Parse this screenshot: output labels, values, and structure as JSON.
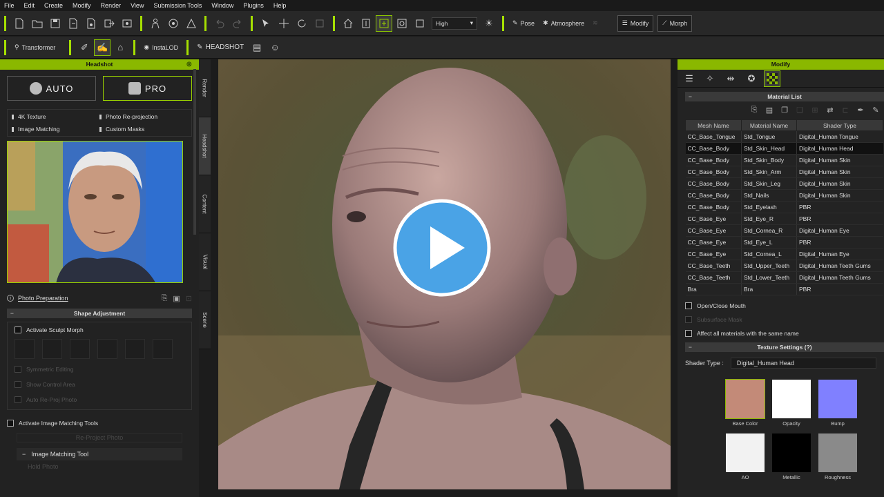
{
  "menu": [
    "File",
    "Edit",
    "Create",
    "Modify",
    "Render",
    "View",
    "Submission Tools",
    "Window",
    "Plugins",
    "Help"
  ],
  "toolbar": {
    "quality": "High",
    "pose": "Pose",
    "atmosphere": "Atmosphere",
    "modify": "Modify",
    "morph": "Morph",
    "transformer": "Transformer",
    "instalod": "InstaLOD",
    "headshot": "HEADSHOT"
  },
  "left": {
    "title": "Headshot",
    "auto": "AUTO",
    "pro": "PRO",
    "features": [
      "4K Texture",
      "Photo Re-projection",
      "Image Matching",
      "Custom Masks"
    ],
    "photo_prep": "Photo Preparation",
    "shape_adjustment": "Shape Adjustment",
    "activate_sculpt": "Activate Sculpt Morph",
    "dim_options": [
      "Symmetric Editing",
      "Show Control Area",
      "Auto Re-Proj Photo"
    ],
    "activate_image_matching": "Activate Image Matching Tools",
    "reproject": "Re-Project Photo",
    "image_matching_tool": "Image Matching Tool",
    "more": "Hold Photo"
  },
  "vtabs": [
    "Render",
    "Headshot",
    "Content",
    "Visual",
    "Scene"
  ],
  "right": {
    "title": "Modify",
    "material_list": "Material List",
    "columns": [
      "Mesh Name",
      "Material Name",
      "Shader Type"
    ],
    "rows": [
      [
        "CC_Base_Tongue",
        "Std_Tongue",
        "Digital_Human Tongue"
      ],
      [
        "CC_Base_Body",
        "Std_Skin_Head",
        "Digital_Human Head"
      ],
      [
        "CC_Base_Body",
        "Std_Skin_Body",
        "Digital_Human Skin"
      ],
      [
        "CC_Base_Body",
        "Std_Skin_Arm",
        "Digital_Human Skin"
      ],
      [
        "CC_Base_Body",
        "Std_Skin_Leg",
        "Digital_Human Skin"
      ],
      [
        "CC_Base_Body",
        "Std_Nails",
        "Digital_Human Skin"
      ],
      [
        "CC_Base_Body",
        "Std_Eyelash",
        "PBR"
      ],
      [
        "CC_Base_Eye",
        "Std_Eye_R",
        "PBR"
      ],
      [
        "CC_Base_Eye",
        "Std_Cornea_R",
        "Digital_Human Eye"
      ],
      [
        "CC_Base_Eye",
        "Std_Eye_L",
        "PBR"
      ],
      [
        "CC_Base_Eye",
        "Std_Cornea_L",
        "Digital_Human Eye"
      ],
      [
        "CC_Base_Teeth",
        "Std_Upper_Teeth",
        "Digital_Human Teeth Gums"
      ],
      [
        "CC_Base_Teeth",
        "Std_Lower_Teeth",
        "Digital_Human Teeth Gums"
      ],
      [
        "Bra",
        "Bra",
        "PBR"
      ]
    ],
    "open_close_mouth": "Open/Close Mouth",
    "disabled_option": "Subsurface Mask",
    "affect_all": "Affect all materials with the same name",
    "texture_settings": "Texture Settings",
    "shader_type_label": "Shader Type :",
    "shader_type_value": "Digital_Human Head",
    "textures": [
      "Base Color",
      "Opacity",
      "Bump",
      "AO",
      "Metallic",
      "Roughness"
    ]
  },
  "colors": {
    "accent": "#8ab800",
    "play": "#4aa3e6"
  }
}
